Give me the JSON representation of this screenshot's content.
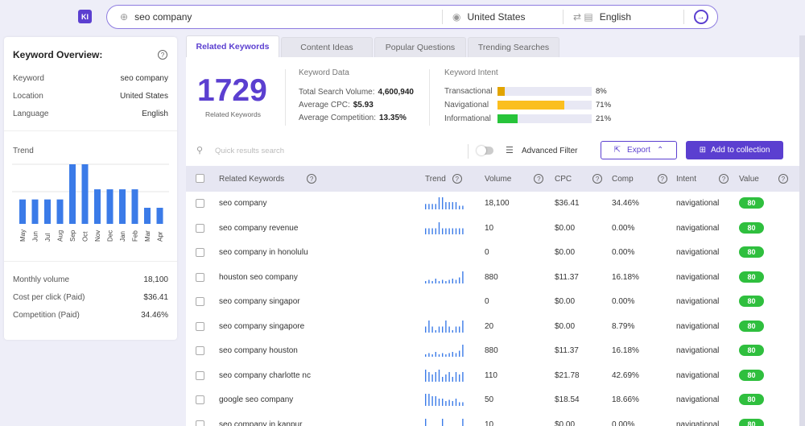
{
  "app": {
    "logo": "KI"
  },
  "search": {
    "keyword": "seo company",
    "location": "United States",
    "language": "English"
  },
  "overview": {
    "title": "Keyword Overview:",
    "rows": [
      {
        "label": "Keyword",
        "value": "seo company"
      },
      {
        "label": "Location",
        "value": "United States"
      },
      {
        "label": "Language",
        "value": "English"
      }
    ],
    "trend_label": "Trend",
    "trend_months": [
      "May",
      "Jun",
      "Jul",
      "Aug",
      "Sep",
      "Oct",
      "Nov",
      "Dec",
      "Jan",
      "Feb",
      "Mar",
      "Apr"
    ],
    "trend_values": [
      0.41,
      0.41,
      0.41,
      0.41,
      1.0,
      1.0,
      0.58,
      0.58,
      0.58,
      0.58,
      0.27,
      0.27
    ],
    "stats": [
      {
        "label": "Monthly volume",
        "value": "18,100"
      },
      {
        "label": "Cost per click (Paid)",
        "value": "$36.41"
      },
      {
        "label": "Competition (Paid)",
        "value": "34.46%"
      }
    ]
  },
  "tabs": [
    {
      "label": "Related Keywords",
      "active": true
    },
    {
      "label": "Content Ideas",
      "active": false
    },
    {
      "label": "Popular Questions",
      "active": false
    },
    {
      "label": "Trending Searches",
      "active": false
    }
  ],
  "summary": {
    "count": "1729",
    "count_label": "Related Keywords",
    "data_title": "Keyword Data",
    "data_rows": [
      {
        "label": "Total Search Volume:",
        "value": "4,600,940"
      },
      {
        "label": "Average CPC:",
        "value": "$5.93"
      },
      {
        "label": "Average Competition:",
        "value": "13.35%"
      }
    ],
    "intent_title": "Keyword Intent",
    "intent_rows": [
      {
        "label": "Transactional",
        "pct": "8%",
        "fraction": 0.08,
        "color": "#e2a400"
      },
      {
        "label": "Navigational",
        "pct": "71%",
        "fraction": 0.71,
        "color": "#fbbf1f"
      },
      {
        "label": "Informational",
        "pct": "21%",
        "fraction": 0.21,
        "color": "#27c43a"
      }
    ]
  },
  "toolbar": {
    "search_placeholder": "Quick results search",
    "advanced_filter": "Advanced Filter",
    "export": "Export",
    "add_to_collection": "Add to collection"
  },
  "table": {
    "headers": {
      "keyword": "Related Keywords",
      "trend": "Trend",
      "volume": "Volume",
      "cpc": "CPC",
      "comp": "Comp",
      "intent": "Intent",
      "value": "Value"
    },
    "rows": [
      {
        "keyword": "seo company",
        "volume": "18,100",
        "cpc": "$36.41",
        "comp": "34.46%",
        "intent": "navigational",
        "value": "80",
        "spark": [
          0.45,
          0.45,
          0.45,
          0.45,
          1,
          1,
          0.6,
          0.6,
          0.6,
          0.6,
          0.3,
          0.3
        ]
      },
      {
        "keyword": "seo company revenue",
        "volume": "10",
        "cpc": "$0.00",
        "comp": "0.00%",
        "intent": "navigational",
        "value": "80",
        "spark": [
          0.5,
          0.5,
          0.5,
          0.5,
          1,
          0.5,
          0.5,
          0.5,
          0.5,
          0.5,
          0.5,
          0.5
        ]
      },
      {
        "keyword": "seo company in honolulu",
        "volume": "0",
        "cpc": "$0.00",
        "comp": "0.00%",
        "intent": "navigational",
        "value": "80",
        "spark": []
      },
      {
        "keyword": "houston seo company",
        "volume": "880",
        "cpc": "$11.37",
        "comp": "16.18%",
        "intent": "navigational",
        "value": "80",
        "spark": [
          0.2,
          0.3,
          0.2,
          0.4,
          0.2,
          0.3,
          0.2,
          0.3,
          0.4,
          0.3,
          0.5,
          1
        ]
      },
      {
        "keyword": "seo company singapor",
        "volume": "0",
        "cpc": "$0.00",
        "comp": "0.00%",
        "intent": "navigational",
        "value": "80",
        "spark": []
      },
      {
        "keyword": "seo company singapore",
        "volume": "20",
        "cpc": "$0.00",
        "comp": "8.79%",
        "intent": "navigational",
        "value": "80",
        "spark": [
          0.5,
          1,
          0.5,
          0.2,
          0.5,
          0.5,
          1,
          0.5,
          0.2,
          0.5,
          0.5,
          1
        ]
      },
      {
        "keyword": "seo company houston",
        "volume": "880",
        "cpc": "$11.37",
        "comp": "16.18%",
        "intent": "navigational",
        "value": "80",
        "spark": [
          0.2,
          0.3,
          0.2,
          0.4,
          0.2,
          0.3,
          0.2,
          0.3,
          0.4,
          0.3,
          0.5,
          1
        ]
      },
      {
        "keyword": "seo company charlotte nc",
        "volume": "110",
        "cpc": "$21.78",
        "comp": "42.69%",
        "intent": "navigational",
        "value": "80",
        "spark": [
          1,
          0.8,
          0.6,
          0.8,
          1,
          0.4,
          0.6,
          0.8,
          0.4,
          0.8,
          0.6,
          0.8
        ]
      },
      {
        "keyword": "google seo company",
        "volume": "50",
        "cpc": "$18.54",
        "comp": "18.66%",
        "intent": "navigational",
        "value": "80",
        "spark": [
          1,
          1,
          0.8,
          0.8,
          0.6,
          0.6,
          0.4,
          0.5,
          0.4,
          0.6,
          0.3,
          0.3
        ]
      },
      {
        "keyword": "seo company in kanpur",
        "volume": "10",
        "cpc": "$0.00",
        "comp": "0.00%",
        "intent": "navigational",
        "value": "80",
        "spark": [
          1,
          0,
          0,
          0,
          0,
          1,
          0,
          0,
          0,
          0,
          0,
          1
        ]
      }
    ]
  }
}
